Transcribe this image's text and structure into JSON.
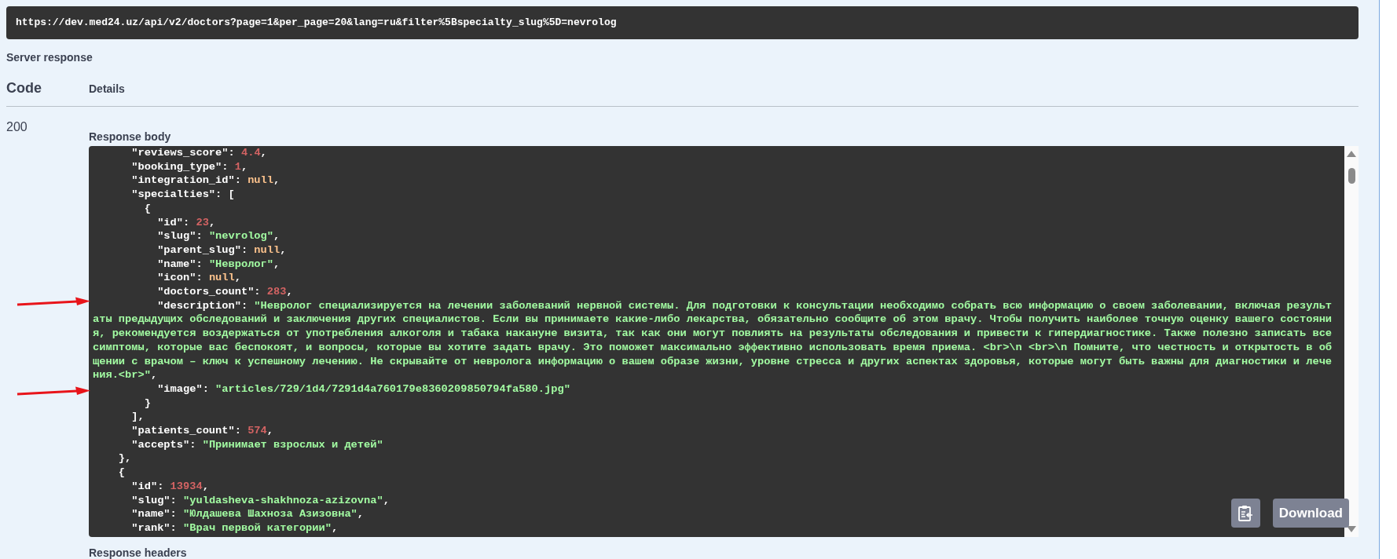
{
  "request_url": "https://dev.med24.uz/api/v2/doctors?page=1&per_page=20&lang=ru&filter%5Bspecialty_slug%5D=nevrolog",
  "server_response_label": "Server response",
  "columns": [
    "Code",
    "Details"
  ],
  "response": {
    "code": "200",
    "body_label": "Response body",
    "lines": [
      [
        {
          "kind": "key",
          "text": "      \"reviews_score\""
        },
        {
          "kind": "punct",
          "text": ": "
        },
        {
          "kind": "number",
          "text": "4.4"
        },
        {
          "kind": "punct",
          "text": ","
        }
      ],
      [
        {
          "kind": "key",
          "text": "      \"booking_type\""
        },
        {
          "kind": "punct",
          "text": ": "
        },
        {
          "kind": "number",
          "text": "1"
        },
        {
          "kind": "punct",
          "text": ","
        }
      ],
      [
        {
          "kind": "key",
          "text": "      \"integration_id\""
        },
        {
          "kind": "punct",
          "text": ": "
        },
        {
          "kind": "null",
          "text": "null"
        },
        {
          "kind": "punct",
          "text": ","
        }
      ],
      [
        {
          "kind": "key",
          "text": "      \"specialties\""
        },
        {
          "kind": "punct",
          "text": ": ["
        }
      ],
      [
        {
          "kind": "punct",
          "text": "        {"
        }
      ],
      [
        {
          "kind": "key",
          "text": "          \"id\""
        },
        {
          "kind": "punct",
          "text": ": "
        },
        {
          "kind": "number",
          "text": "23"
        },
        {
          "kind": "punct",
          "text": ","
        }
      ],
      [
        {
          "kind": "key",
          "text": "          \"slug\""
        },
        {
          "kind": "punct",
          "text": ": "
        },
        {
          "kind": "string",
          "text": "\"nevrolog\""
        },
        {
          "kind": "punct",
          "text": ","
        }
      ],
      [
        {
          "kind": "key",
          "text": "          \"parent_slug\""
        },
        {
          "kind": "punct",
          "text": ": "
        },
        {
          "kind": "null",
          "text": "null"
        },
        {
          "kind": "punct",
          "text": ","
        }
      ],
      [
        {
          "kind": "key",
          "text": "          \"name\""
        },
        {
          "kind": "punct",
          "text": ": "
        },
        {
          "kind": "string",
          "text": "\"Невролог\""
        },
        {
          "kind": "punct",
          "text": ","
        }
      ],
      [
        {
          "kind": "key",
          "text": "          \"icon\""
        },
        {
          "kind": "punct",
          "text": ": "
        },
        {
          "kind": "null",
          "text": "null"
        },
        {
          "kind": "punct",
          "text": ","
        }
      ],
      [
        {
          "kind": "key",
          "text": "          \"doctors_count\""
        },
        {
          "kind": "punct",
          "text": ": "
        },
        {
          "kind": "number",
          "text": "283"
        },
        {
          "kind": "punct",
          "text": ","
        }
      ],
      [
        {
          "kind": "key",
          "text": "          \"description\""
        },
        {
          "kind": "punct",
          "text": ": "
        },
        {
          "kind": "string",
          "text": "\"Невролог специализируется на лечении заболеваний нервной системы. Для подготовки к консультации необходимо собрать всю информацию о своем заболевании, включая результаты предыдущих обследований и заключения других специалистов. Если вы принимаете какие-либо лекарства, обязательно сообщите об этом врачу. Чтобы получить наиболее точную оценку вашего состояния, рекомендуется воздержаться от употребления алкоголя и табака накануне визита, так как они могут повлиять на результаты обследования и привести к гипердиагностике. Также полезно записать все симптомы, которые вас беспокоят, и вопросы, которые вы хотите задать врачу. Это поможет максимально эффективно использовать время приема. <br>\\n <br>\\n Помните, что честность и открытость в общении с врачом – ключ к успешному лечению. Не скрывайте от невролога информацию о вашем образе жизни, уровне стресса и других аспектах здоровья, которые могут быть важны для диагностики и лечения.<br>\""
        },
        {
          "kind": "punct",
          "text": ","
        }
      ],
      [
        {
          "kind": "key",
          "text": "          \"image\""
        },
        {
          "kind": "punct",
          "text": ": "
        },
        {
          "kind": "string",
          "text": "\"articles/729/1d4/7291d4a760179e8360209850794fa580.jpg\""
        }
      ],
      [
        {
          "kind": "punct",
          "text": "        }"
        }
      ],
      [
        {
          "kind": "punct",
          "text": "      ],"
        }
      ],
      [
        {
          "kind": "key",
          "text": "      \"patients_count\""
        },
        {
          "kind": "punct",
          "text": ": "
        },
        {
          "kind": "number",
          "text": "574"
        },
        {
          "kind": "punct",
          "text": ","
        }
      ],
      [
        {
          "kind": "key",
          "text": "      \"accepts\""
        },
        {
          "kind": "punct",
          "text": ": "
        },
        {
          "kind": "string",
          "text": "\"Принимает взрослых и детей\""
        }
      ],
      [
        {
          "kind": "punct",
          "text": "    },"
        }
      ],
      [
        {
          "kind": "punct",
          "text": "    {"
        }
      ],
      [
        {
          "kind": "key",
          "text": "      \"id\""
        },
        {
          "kind": "punct",
          "text": ": "
        },
        {
          "kind": "number",
          "text": "13934"
        },
        {
          "kind": "punct",
          "text": ","
        }
      ],
      [
        {
          "kind": "key",
          "text": "      \"slug\""
        },
        {
          "kind": "punct",
          "text": ": "
        },
        {
          "kind": "string",
          "text": "\"yuldasheva-shakhnoza-azizovna\""
        },
        {
          "kind": "punct",
          "text": ","
        }
      ],
      [
        {
          "kind": "key",
          "text": "      \"name\""
        },
        {
          "kind": "punct",
          "text": ": "
        },
        {
          "kind": "string",
          "text": "\"Юлдашева Шахноза Азизовна\""
        },
        {
          "kind": "punct",
          "text": ","
        }
      ],
      [
        {
          "kind": "key",
          "text": "      \"rank\""
        },
        {
          "kind": "punct",
          "text": ": "
        },
        {
          "kind": "string",
          "text": "\"Врач первой категории\""
        },
        {
          "kind": "punct",
          "text": ","
        }
      ]
    ],
    "download_label": "Download",
    "headers_label": "Response headers"
  }
}
